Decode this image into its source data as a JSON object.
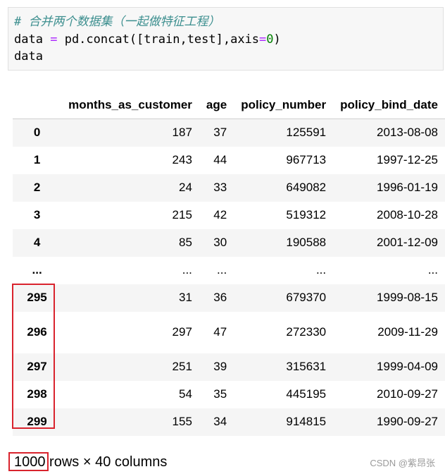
{
  "code_cell": {
    "comment": "# 合并两个数据集（一起做特征工程）",
    "line2_var": "data",
    "line2_eq": "=",
    "line2_call": "pd.concat([train,test],axis",
    "line2_eq2": "=",
    "line2_zero": "0",
    "line2_close": ")",
    "line3": "data"
  },
  "table": {
    "columns": [
      "",
      "months_as_customer",
      "age",
      "policy_number",
      "policy_bind_date"
    ],
    "rows": [
      {
        "index": "0",
        "cells": [
          "187",
          "37",
          "125591",
          "2013-08-08"
        ]
      },
      {
        "index": "1",
        "cells": [
          "243",
          "44",
          "967713",
          "1997-12-25"
        ]
      },
      {
        "index": "2",
        "cells": [
          "24",
          "33",
          "649082",
          "1996-01-19"
        ]
      },
      {
        "index": "3",
        "cells": [
          "215",
          "42",
          "519312",
          "2008-10-28"
        ]
      },
      {
        "index": "4",
        "cells": [
          "85",
          "30",
          "190588",
          "2001-12-09"
        ]
      },
      {
        "index": "...",
        "cells": [
          "...",
          "...",
          "...",
          "..."
        ]
      },
      {
        "index": "295",
        "cells": [
          "31",
          "36",
          "679370",
          "1999-08-15"
        ]
      },
      {
        "index": "296",
        "cells": [
          "297",
          "47",
          "272330",
          "2009-11-29"
        ]
      },
      {
        "index": "297",
        "cells": [
          "251",
          "39",
          "315631",
          "1999-04-09"
        ]
      },
      {
        "index": "298",
        "cells": [
          "54",
          "35",
          "445195",
          "2010-09-27"
        ]
      },
      {
        "index": "299",
        "cells": [
          "155",
          "34",
          "914815",
          "1990-09-27"
        ]
      }
    ]
  },
  "shape": {
    "rows": "1000",
    "rest": " rows × 40 columns"
  },
  "watermark": "CSDN @紫昂张",
  "colors": {
    "highlight_box": "#d9232d",
    "comment": "#3d8f8f",
    "operator": "#aa22ff",
    "number": "#008000"
  }
}
